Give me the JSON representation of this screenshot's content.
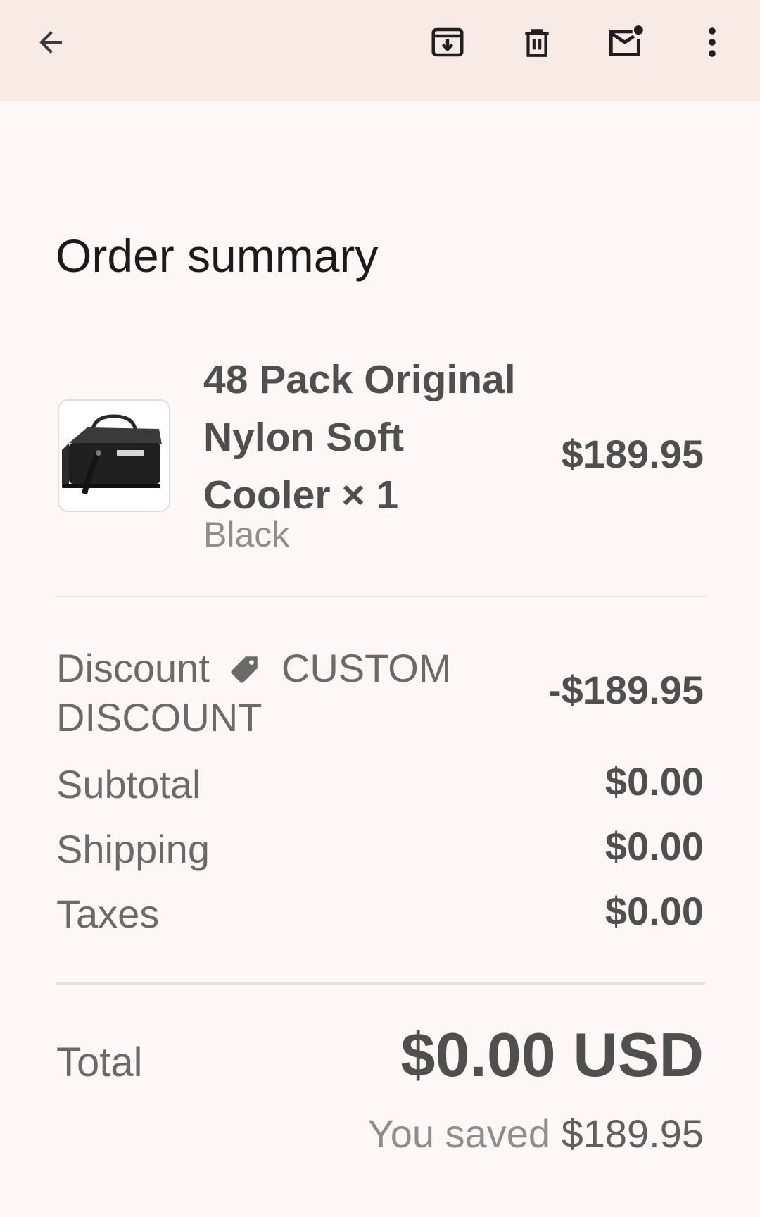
{
  "toolbar": {
    "back_icon": "arrow-back-icon",
    "archive_icon": "archive-icon",
    "delete_icon": "trash-icon",
    "unread_icon": "mark-unread-icon",
    "more_icon": "more-vert-icon"
  },
  "order": {
    "title": "Order summary",
    "item": {
      "name": "48 Pack Original Nylon Soft Cooler × 1",
      "variant": "Black",
      "price": "$189.95",
      "image_alt": "black soft cooler bag"
    },
    "discount": {
      "label": "Discount",
      "code": "CUSTOM DISCOUNT",
      "value": "-$189.95",
      "icon": "tag-icon"
    },
    "subtotal": {
      "label": "Subtotal",
      "value": "$0.00"
    },
    "shipping": {
      "label": "Shipping",
      "value": "$0.00"
    },
    "taxes": {
      "label": "Taxes",
      "value": "$0.00"
    },
    "total": {
      "label": "Total",
      "value": "$0.00 USD"
    },
    "saved": {
      "label": "You saved",
      "value": "$189.95"
    }
  },
  "colors": {
    "toolbar_bg": "#f8ebe6",
    "page_bg": "#fdf7f5",
    "title": "#1b1b1b",
    "text": "#4f4f4f",
    "muted": "#8e8e8e"
  }
}
